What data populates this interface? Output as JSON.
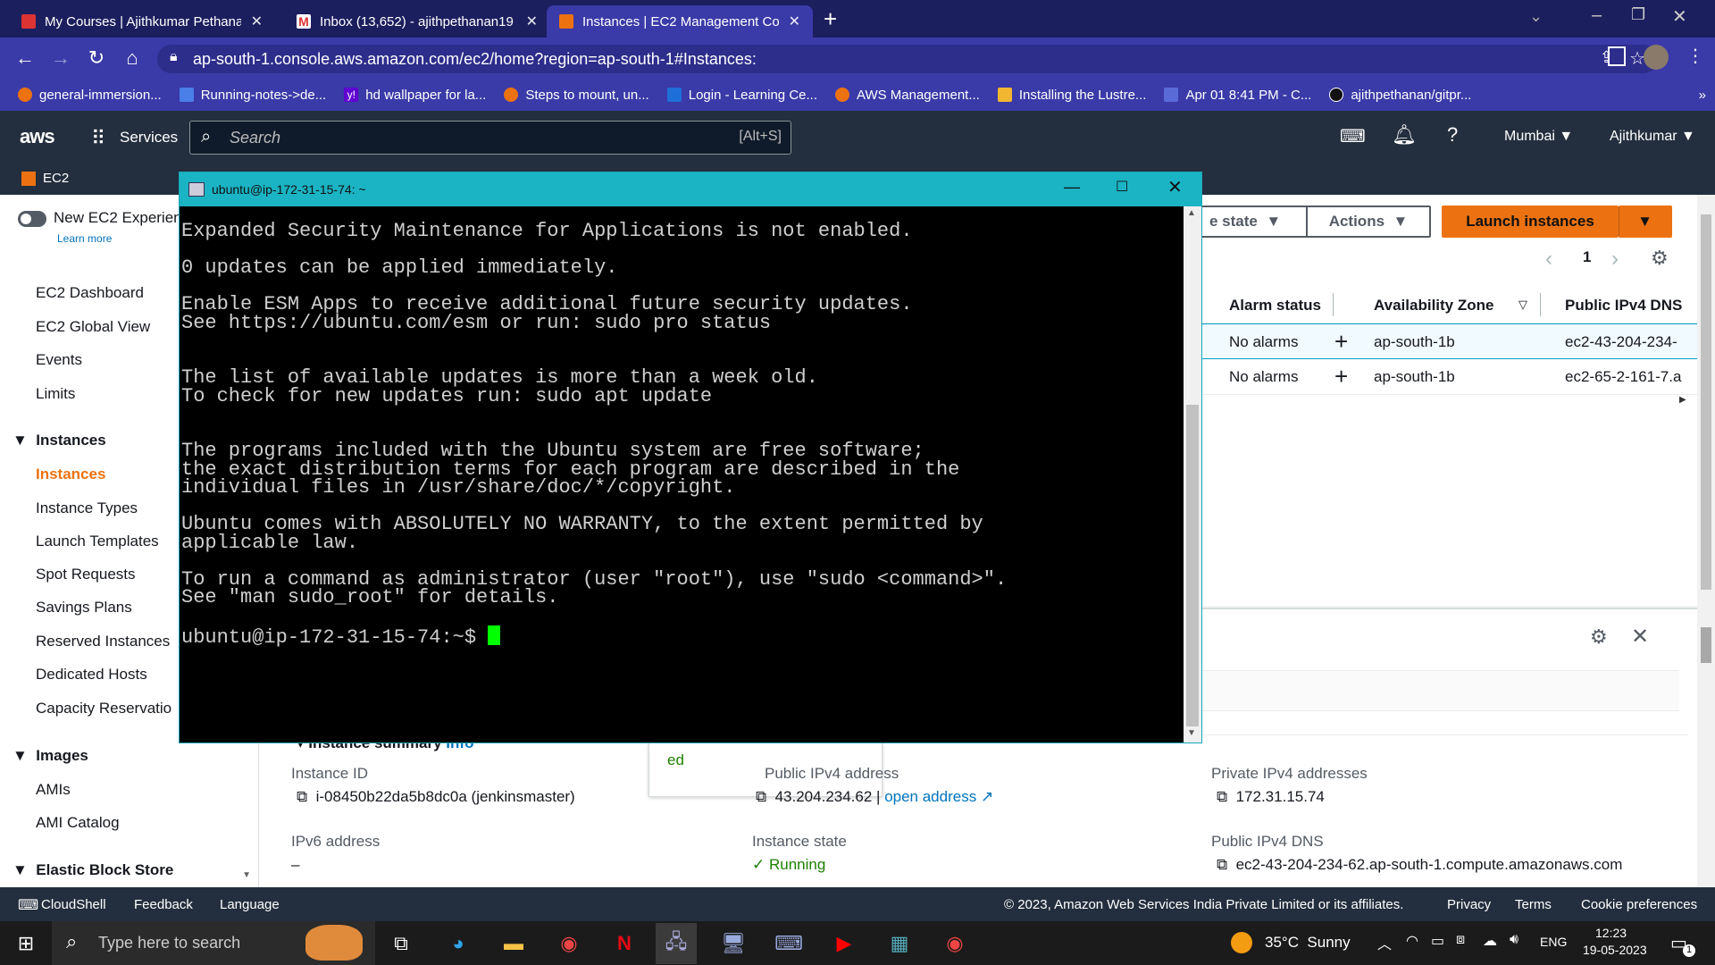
{
  "browser": {
    "tabs": [
      {
        "title": "My Courses | Ajithkumar Pethana",
        "favicon": "ribbon-icon"
      },
      {
        "title": "Inbox (13,652) - ajithpethanan19",
        "favicon": "gmail-icon"
      },
      {
        "title": "Instances | EC2 Management Co",
        "favicon": "ec2-icon"
      }
    ],
    "url": "ap-south-1.console.aws.amazon.com/ec2/home?region=ap-south-1#Instances:",
    "bookmarks": [
      "general-immersion...",
      "Running-notes->de...",
      "hd wallpaper for la...",
      "Steps to mount, un...",
      "Login - Learning Ce...",
      "AWS Management...",
      "Installing the Lustre...",
      "Apr 01 8:41 PM - C...",
      "ajithpethanan/gitpr..."
    ]
  },
  "aws": {
    "logo": "aws",
    "services_label": "Services",
    "search_placeholder": "Search",
    "search_shortcut": "[Alt+S]",
    "region": "Mumbai",
    "user": "Ajithkumar",
    "service_tag": "EC2"
  },
  "sidebar": {
    "new_experience": "New EC2 Experien",
    "learn_more": "Learn more",
    "top": [
      "EC2 Dashboard",
      "EC2 Global View",
      "Events",
      "Limits"
    ],
    "instances_header": "Instances",
    "instances": [
      "Instances",
      "Instance Types",
      "Launch Templates",
      "Spot Requests",
      "Savings Plans",
      "Reserved Instances",
      "Dedicated Hosts",
      "Capacity Reservatio"
    ],
    "images_header": "Images",
    "images": [
      "AMIs",
      "AMI Catalog"
    ],
    "ebs_header": "Elastic Block Store"
  },
  "main": {
    "state_btn": "e state",
    "actions_btn": "Actions",
    "launch_btn": "Launch instances",
    "page_number": "1",
    "columns": [
      "Alarm status",
      "Availability Zone",
      "Public IPv4 DNS"
    ],
    "rows": [
      {
        "alarm": "No alarms",
        "az": "ap-south-1b",
        "dns": "ec2-43-204-234-"
      },
      {
        "alarm": "No alarms",
        "az": "ap-south-1b",
        "dns": "ec2-65-2-161-7.a"
      }
    ],
    "summary_title": "Instance summary",
    "info": "Info",
    "tooltip_fragment": "ed",
    "details": {
      "instance_id_label": "Instance ID",
      "instance_id": "i-08450b22da5b8dc0a (jenkinsmaster)",
      "public_ip_label": "Public IPv4 address",
      "public_ip": "43.204.234.62",
      "open_address": "open address",
      "private_ip_label": "Private IPv4 addresses",
      "private_ip": "172.31.15.74",
      "ipv6_label": "IPv6 address",
      "ipv6": "–",
      "state_label": "Instance state",
      "state": "Running",
      "public_dns_label": "Public IPv4 DNS",
      "public_dns": "ec2-43-204-234-62.ap-south-1.compute.amazonaws.com"
    }
  },
  "footer": {
    "cloudshell": "CloudShell",
    "feedback": "Feedback",
    "language": "Language",
    "copyright": "© 2023, Amazon Web Services India Private Limited or its affiliates.",
    "links": [
      "Privacy",
      "Terms",
      "Cookie preferences"
    ]
  },
  "terminal": {
    "title": "ubuntu@ip-172-31-15-74: ~",
    "lines": [
      "Expanded Security Maintenance for Applications is not enabled.",
      "",
      "0 updates can be applied immediately.",
      "",
      "Enable ESM Apps to receive additional future security updates.",
      "See https://ubuntu.com/esm or run: sudo pro status",
      "",
      "",
      "The list of available updates is more than a week old.",
      "To check for new updates run: sudo apt update",
      "",
      "",
      "The programs included with the Ubuntu system are free software;",
      "the exact distribution terms for each program are described in the",
      "individual files in /usr/share/doc/*/copyright.",
      "",
      "Ubuntu comes with ABSOLUTELY NO WARRANTY, to the extent permitted by",
      "applicable law.",
      "",
      "To run a command as administrator (user \"root\"), use \"sudo <command>\".",
      "See \"man sudo_root\" for details.",
      ""
    ],
    "prompt": "ubuntu@ip-172-31-15-74:~$ ",
    "cursor_color": "#00ff00"
  },
  "taskbar": {
    "search_placeholder": "Type here to search",
    "weather": "35°C  Sunny",
    "lang": "ENG",
    "time": "12:23",
    "date": "19-05-2023",
    "notifications": "1",
    "apps": [
      "task-view-icon",
      "edge-icon",
      "file-explorer-icon",
      "chrome-icon",
      "netflix-icon",
      "putty-icon",
      "remote-desktop-icon",
      "keyboard-icon",
      "youtube-icon",
      "store-icon",
      "chrome-profile-icon"
    ]
  },
  "colors": {
    "tabstrip": "#1c1f5e",
    "toolbar": "#3a3aa8",
    "aws_nav": "#232f3e",
    "aws_orange": "#ec7211",
    "terminal_titlebar": "#1ab4c4",
    "running_green": "#1d8102"
  }
}
